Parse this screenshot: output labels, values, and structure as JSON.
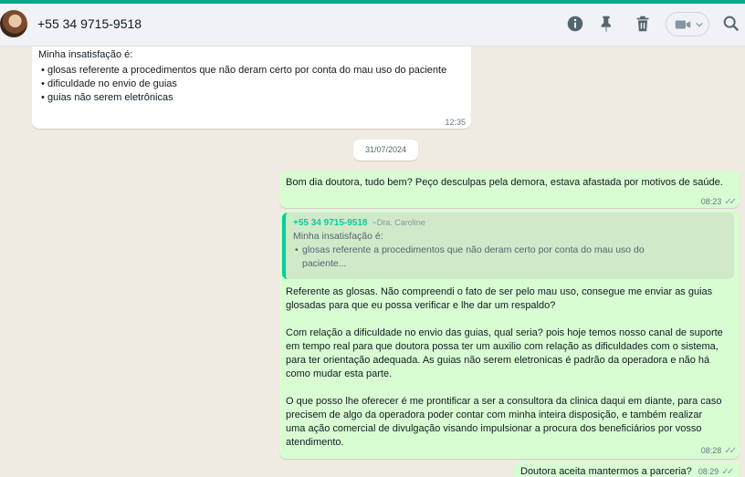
{
  "header": {
    "contact_name": "+55 34 9715-9518",
    "icons": [
      "info-icon",
      "pin-icon",
      "trash-icon",
      "video-call-icon",
      "chevron-down-icon",
      "search-icon"
    ]
  },
  "colors": {
    "accent": "#00a884",
    "incoming_bubble": "#ffffff",
    "outgoing_bubble": "#d9fdd3",
    "chat_background": "#efeae2"
  },
  "messages": {
    "incoming": {
      "heading": "Minha insatisfação é:",
      "points": [
        "glosas referente a procedimentos que não deram certo por conta do mau uso do paciente",
        "dificuldade no envio de guias",
        "guias não serem eletrônicas"
      ],
      "time": "12:35"
    },
    "date_chip": "31/07/2024",
    "greeting": {
      "text": "Bom dia doutora, tudo bem? Peço desculpas pela demora, estava afastada por motivos de saúde.",
      "time": "08:23"
    },
    "reply": {
      "quote_sender": "+55 34 9715-9518",
      "quote_name": "~Dra. Caroline",
      "quote_heading": "Minha insatisfação é:",
      "quote_point": "glosas referente a procedimentos que não deram certo por conta do mau uso do paciente...",
      "paragraphs": [
        "Referente as glosas. Não compreendi o fato de ser pelo mau uso, consegue me enviar as guias glosadas para que eu possa verificar e lhe dar um respaldo?",
        "Com relação a dificuldade no envio das guias, qual seria? pois hoje temos nosso canal de suporte em tempo real para que doutora possa ter um auxilio com relação as dificuldades com o sistema, para ter orientação adequada. As guias não serem eletronicas é padrão da operadora e não há como mudar esta parte.",
        "O que posso lhe oferecer é me prontificar a ser a consultora da clinica daqui em diante, para caso precisem de algo da operadora poder contar com minha inteira disposição, e também realizar uma ação comercial de divulgação visando impulsionar a procura dos beneficiários por vosso atendimento."
      ],
      "time": "08:28"
    },
    "last": {
      "text": "Doutora aceita mantermos a parceria?",
      "time": "08:29"
    }
  }
}
